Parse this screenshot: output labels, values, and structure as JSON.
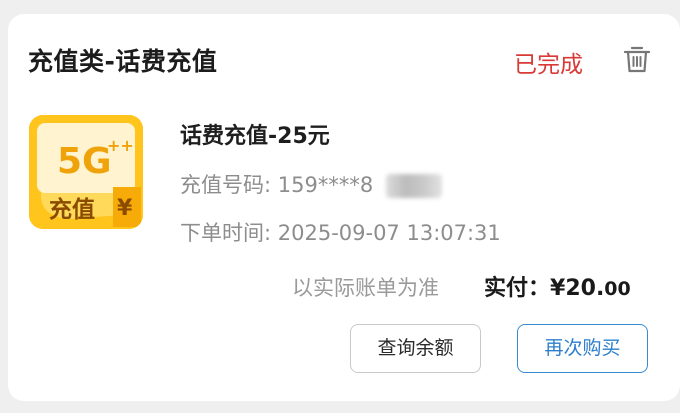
{
  "order": {
    "category": "充值类-话费充值",
    "status": "已完成",
    "status_color": "#d83a35",
    "delete_icon": "trash-icon",
    "product": {
      "title": "话费充值-25元",
      "thumbnail": {
        "badge_text": "5G",
        "label": "充值",
        "currency_symbol": "¥",
        "color": "#ffc61f"
      }
    },
    "phone_label": "充值号码: 159****8",
    "time_label": "下单时间: 2025-09-07 13:07:31",
    "note": "以实际账单为准",
    "paid_label": "实付：",
    "paid_amount_main": "¥20.",
    "paid_amount_decimals": "00"
  },
  "actions": {
    "check_balance": "查询余额",
    "rebuy": "再次购买",
    "rebuy_color": "#2d7fcc"
  }
}
